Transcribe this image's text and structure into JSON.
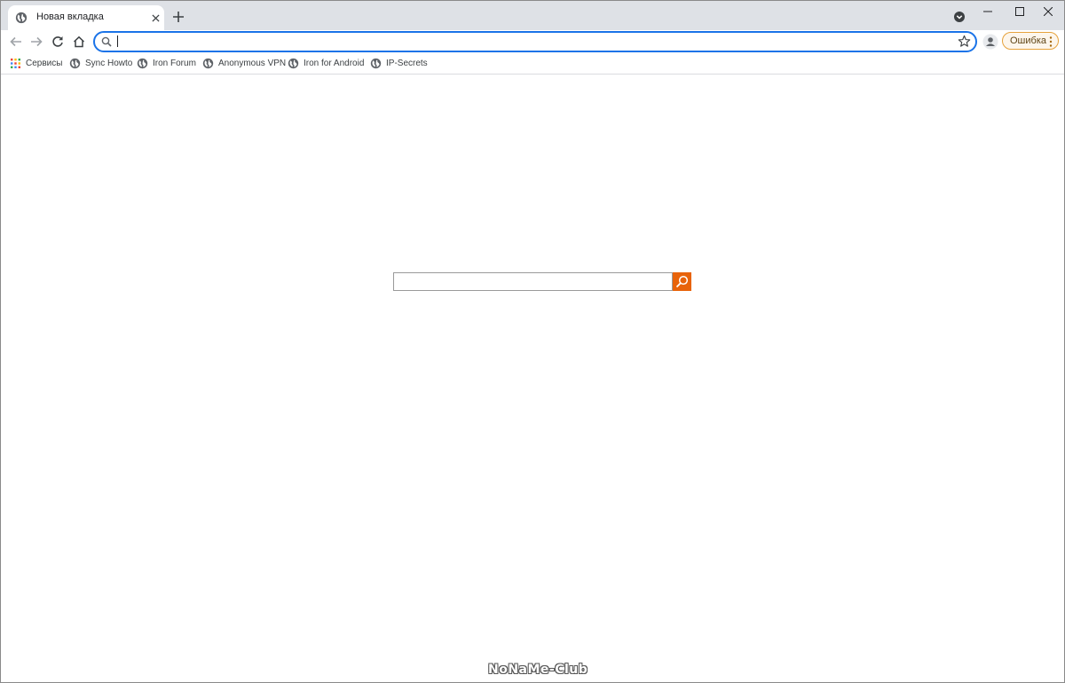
{
  "tab": {
    "title": "Новая вкладка",
    "favicon": "globe-icon",
    "close_icon": "close-icon"
  },
  "tabstrip": {
    "new_tab_icon": "plus-icon",
    "tab_search_icon": "tab-search-icon"
  },
  "window_controls": [
    "minimize-icon",
    "maximize-icon",
    "close-icon"
  ],
  "toolbar": {
    "back_icon": "back-arrow-icon",
    "forward_icon": "forward-arrow-icon",
    "reload_icon": "reload-icon",
    "home_icon": "home-icon",
    "address_value": "",
    "address_placeholder": "",
    "bookmark_star_icon": "star-icon",
    "profile_icon": "person-icon",
    "error_label": "Ошибка",
    "menu_icon": "kebab-menu-icon"
  },
  "bookmarks": [
    {
      "label": "Сервисы",
      "icon": "apps-grid-icon"
    },
    {
      "label": "Sync Howto",
      "icon": "globe-icon"
    },
    {
      "label": "Iron Forum",
      "icon": "globe-icon"
    },
    {
      "label": "Anonymous VPN",
      "icon": "globe-icon"
    },
    {
      "label": "Iron for Android",
      "icon": "globe-icon"
    },
    {
      "label": "IP-Secrets",
      "icon": "globe-icon"
    }
  ],
  "page": {
    "search_value": "",
    "search_icon": "magnifier-icon",
    "search_button_color": "#e8630a"
  },
  "watermark": "NoNaMe-Club",
  "colors": {
    "tabstrip_bg": "#dee1e6",
    "omnibox_focus": "#1a73e8",
    "error_border": "#e6a23c"
  }
}
